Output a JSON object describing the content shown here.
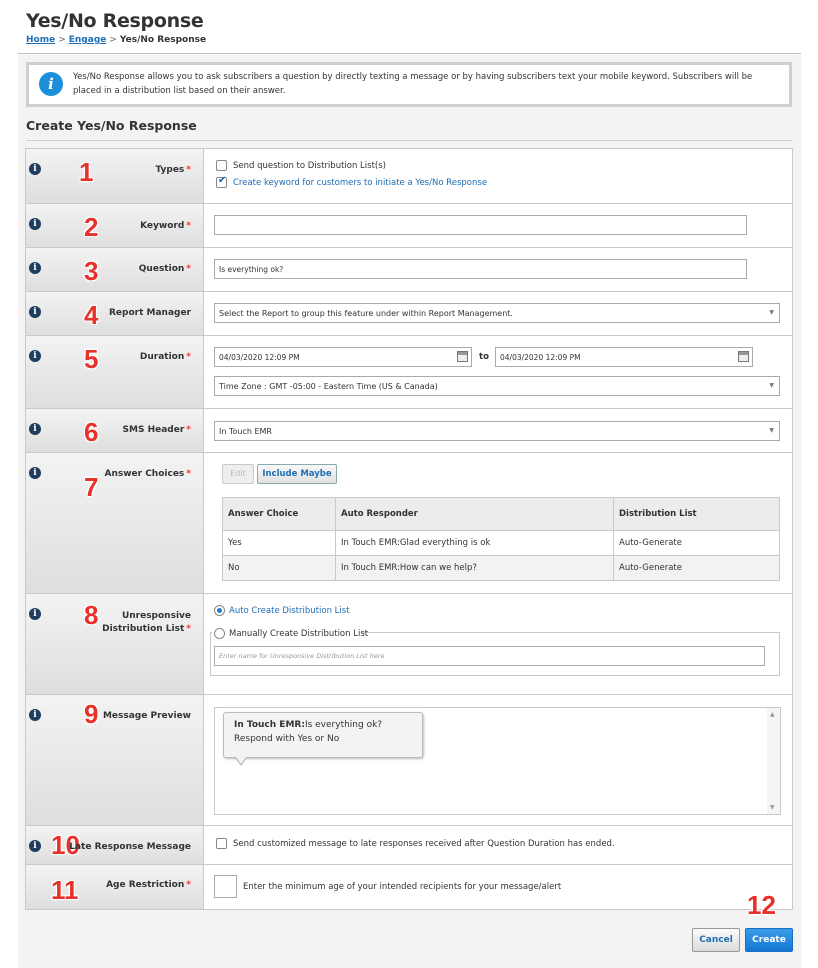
{
  "page": {
    "title": "Yes/No Response",
    "breadcrumb": {
      "home": "Home",
      "engage": "Engage",
      "current": "Yes/No Response",
      "sep": ">"
    }
  },
  "banner": {
    "icon": "info-icon",
    "text": "Yes/No Response allows you to ask subscribers a question by directly texting a message or by having subscribers text your mobile keyword. Subscribers will be placed in a distribution list based on their answer."
  },
  "section_title": "Create Yes/No Response",
  "required_mark": "*",
  "rows": {
    "types": {
      "num": "1",
      "label": "Types",
      "opt1": "Send question to Distribution List(s)",
      "opt2": "Create keyword for customers to initiate a Yes/No Response"
    },
    "keyword": {
      "num": "2",
      "label": "Keyword",
      "value": ""
    },
    "question": {
      "num": "3",
      "label": "Question",
      "value": "Is everything ok?"
    },
    "report": {
      "num": "4",
      "label": "Report Manager",
      "value": "Select the Report to group this feature under within Report Management."
    },
    "duration": {
      "num": "5",
      "label": "Duration",
      "start": "04/03/2020 12:09 PM",
      "to": "to",
      "end": "04/03/2020 12:09 PM",
      "timezone": "Time Zone : GMT -05:00 - Eastern Time (US & Canada)"
    },
    "sms": {
      "num": "6",
      "label": "SMS Header",
      "value": "In Touch EMR"
    },
    "answers": {
      "num": "7",
      "label": "Answer Choices",
      "edit": "Edit",
      "include_maybe": "Include Maybe",
      "headers": [
        "Answer Choice",
        "Auto Responder",
        "Distribution List"
      ],
      "rows": [
        [
          "Yes",
          "In Touch EMR:Glad everything is ok",
          "Auto-Generate"
        ],
        [
          "No",
          "In Touch EMR:How can we help?",
          "Auto-Generate"
        ]
      ]
    },
    "unresponsive": {
      "num": "8",
      "label1": "Unresponsive",
      "label2": "Distribution List",
      "auto": "Auto Create Distribution List",
      "manual": "Manually Create Distribution List",
      "placeholder": "Enter name for Unresponsive Distribution List here"
    },
    "preview": {
      "num": "9",
      "label": "Message Preview",
      "sender": "In Touch EMR:",
      "body": "Is everything ok? Respond with Yes or No"
    },
    "late": {
      "num": "10",
      "label": "Late Response Message",
      "text": "Send customized message to late responses received after Question Duration has ended."
    },
    "age": {
      "num": "11",
      "label": "Age Restriction",
      "text": "Enter the minimum age of your intended recipients for your message/alert"
    }
  },
  "actions": {
    "num": "12",
    "cancel": "Cancel",
    "create": "Create"
  },
  "colors": {
    "accent": "#1c8fd8",
    "step_number": "#e8312b",
    "link": "#1f6fb5"
  }
}
